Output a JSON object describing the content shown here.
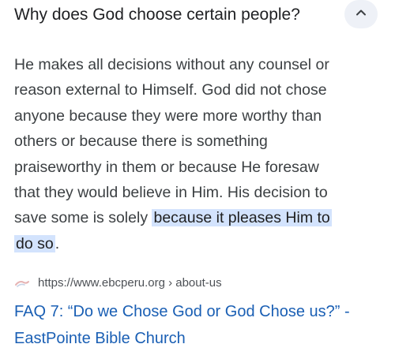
{
  "question": {
    "title": "Why does God choose certain people?",
    "collapse_icon": "chevron-up-icon"
  },
  "answer": {
    "lines": [
      "He makes all decisions without any counsel or",
      "reason external to Himself. God did not chose",
      "anyone because they were more worthy than",
      "others or because there is something",
      "praiseworthy in them or because He foresaw",
      "that they would believe in Him. His decision to"
    ],
    "line7_plain": "save some is solely ",
    "line7_highlight": "because it pleases Him to",
    "line8_highlight": "do so",
    "line8_plain": "."
  },
  "source": {
    "favicon": "site-favicon-icon",
    "url": "https://www.ebcperu.org › about-us"
  },
  "result": {
    "title_line1": "FAQ 7: “Do we Chose God or God Chose us?” -",
    "title_line2": "EastPointe Bible Church"
  },
  "colors": {
    "link": "#1a5fb4",
    "highlight": "#d3e3fd",
    "button_bg": "#eef1f7"
  }
}
